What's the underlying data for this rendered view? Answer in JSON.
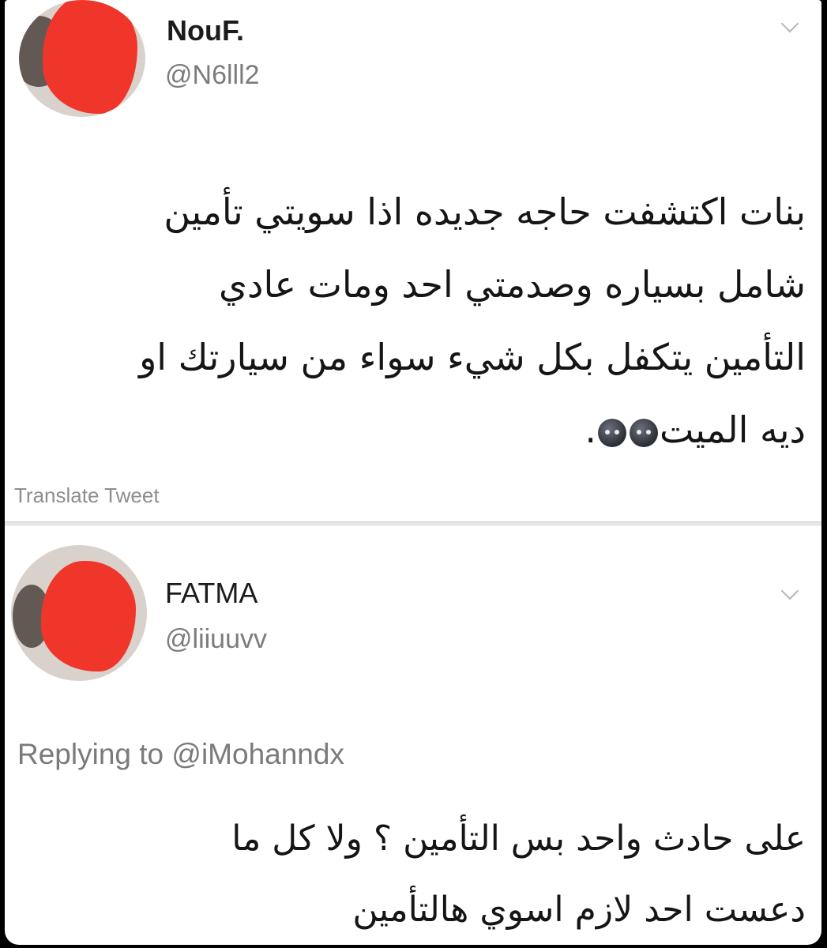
{
  "tweets": [
    {
      "name": "NouF.",
      "handle": "@N6lll2",
      "lines": [
        "بنات اكتشفت حاجه جديده اذا سويتي تأمين",
        "شامل بسياره وصدمتي احد ومات عادي",
        "التأمين يتكفل بكل شيء سواء من سيارتك او",
        "ديه الميت"
      ],
      "line4_suffix": ".",
      "emoji": [
        "worried-face-emoji",
        "worried-face-emoji"
      ],
      "translate_label": "Translate Tweet",
      "icons": {
        "menu": "chevron-down-icon",
        "avatar": "avatar-redacted"
      }
    },
    {
      "name": "FATMA",
      "handle": "@liiuuvv",
      "replying_prefix": "Replying to",
      "replying_handle": "@iMohanndx",
      "lines": [
        "على حادث واحد بس التأمين ؟ ولا كل ما",
        "دعست احد لازم اسوي هالتأمين"
      ],
      "icons": {
        "menu": "chevron-down-icon",
        "avatar": "avatar-redacted"
      }
    }
  ],
  "colors": {
    "redaction": "#f0352a",
    "background": "#ffffff",
    "secondary_text": "#7c7c7c"
  }
}
